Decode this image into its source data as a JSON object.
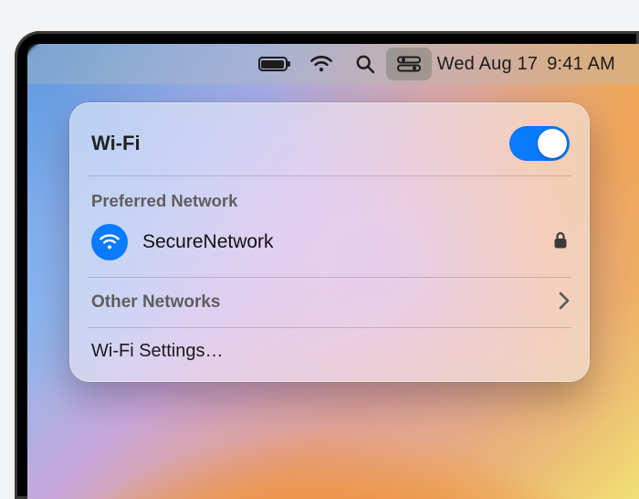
{
  "menubar": {
    "date": "Wed Aug 17",
    "time": "9:41 AM"
  },
  "panel": {
    "title": "Wi-Fi",
    "wifi_on": true,
    "sections": {
      "preferred_header": "Preferred Network",
      "network_name": "SecureNetwork",
      "network_locked": true,
      "other_header": "Other Networks",
      "settings_label": "Wi-Fi Settings…"
    }
  },
  "colors": {
    "accent": "#0a7aff"
  }
}
